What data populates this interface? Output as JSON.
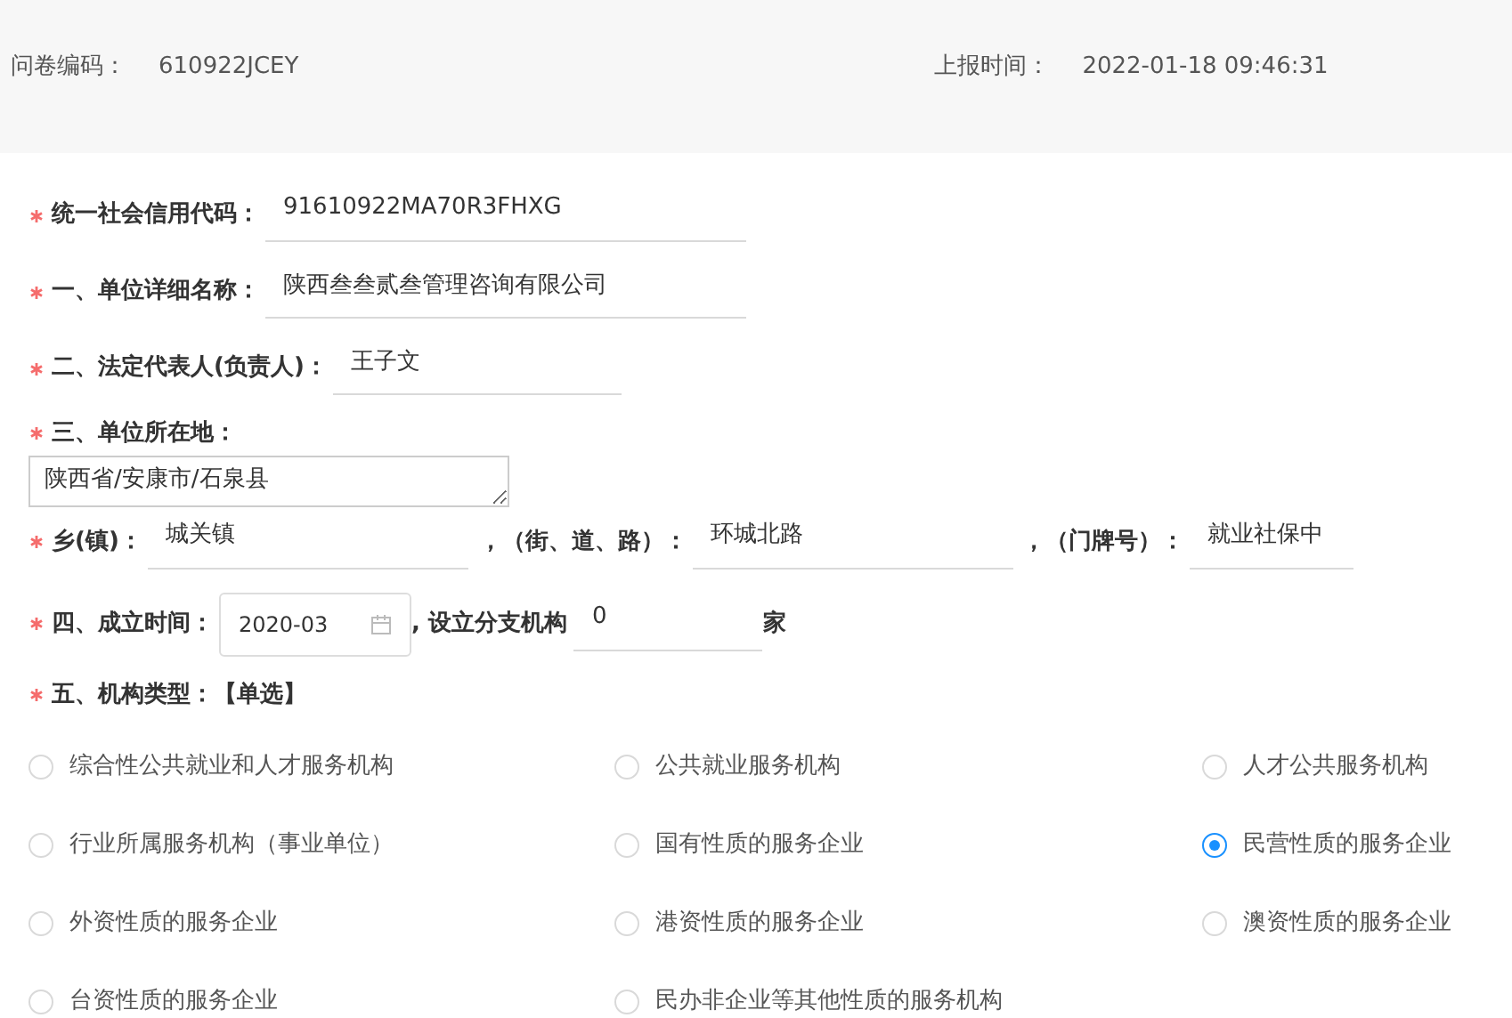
{
  "header": {
    "left": {
      "label": "问卷编码：",
      "value": "610922JCEY"
    },
    "right": {
      "label": "上报时间：",
      "value": "2022-01-18 09:46:31"
    }
  },
  "credit_code": {
    "label": "统一社会信用代码：",
    "required": true,
    "value": "91610922MA70R3FHXG"
  },
  "unit_name": {
    "label": "一、单位详细名称：",
    "required": true,
    "value": "陕西叁叁贰叁管理咨询有限公司"
  },
  "legal_rep": {
    "label": "二、法定代表人(负责人)：",
    "required": true,
    "value": "王子文"
  },
  "address": {
    "label": "三、单位所在地：",
    "required": true,
    "value": "陕西省/安康市/石泉县"
  },
  "locality": {
    "required": true,
    "parts": [
      {
        "label": "乡(镇)：",
        "value": "城关镇"
      },
      {
        "label": "，（街、道、路）：",
        "value": "环城北路"
      },
      {
        "label": "，（门牌号）：",
        "value": "就业社保中"
      }
    ]
  },
  "founding": {
    "label": "四、成立时间：",
    "required": true,
    "date": "2020-03",
    "branches_label": ", 设立分支机构",
    "branches": "0",
    "unit": "家"
  },
  "org_type": {
    "label": "五、机构类型：【单选】",
    "required": true,
    "options": [
      {
        "label": "综合性公共就业和人才服务机构",
        "selected": false
      },
      {
        "label": "公共就业服务机构",
        "selected": false
      },
      {
        "label": "人才公共服务机构",
        "selected": false
      },
      {
        "label": "行业所属服务机构（事业单位）",
        "selected": false
      },
      {
        "label": "国有性质的服务企业",
        "selected": false
      },
      {
        "label": "民营性质的服务企业",
        "selected": true
      },
      {
        "label": "外资性质的服务企业",
        "selected": false
      },
      {
        "label": "港资性质的服务企业",
        "selected": false
      },
      {
        "label": "澳资性质的服务企业",
        "selected": false
      },
      {
        "label": "台资性质的服务企业",
        "selected": false
      },
      {
        "label": "民办非企业等其他性质的服务机构",
        "selected": false
      }
    ]
  }
}
